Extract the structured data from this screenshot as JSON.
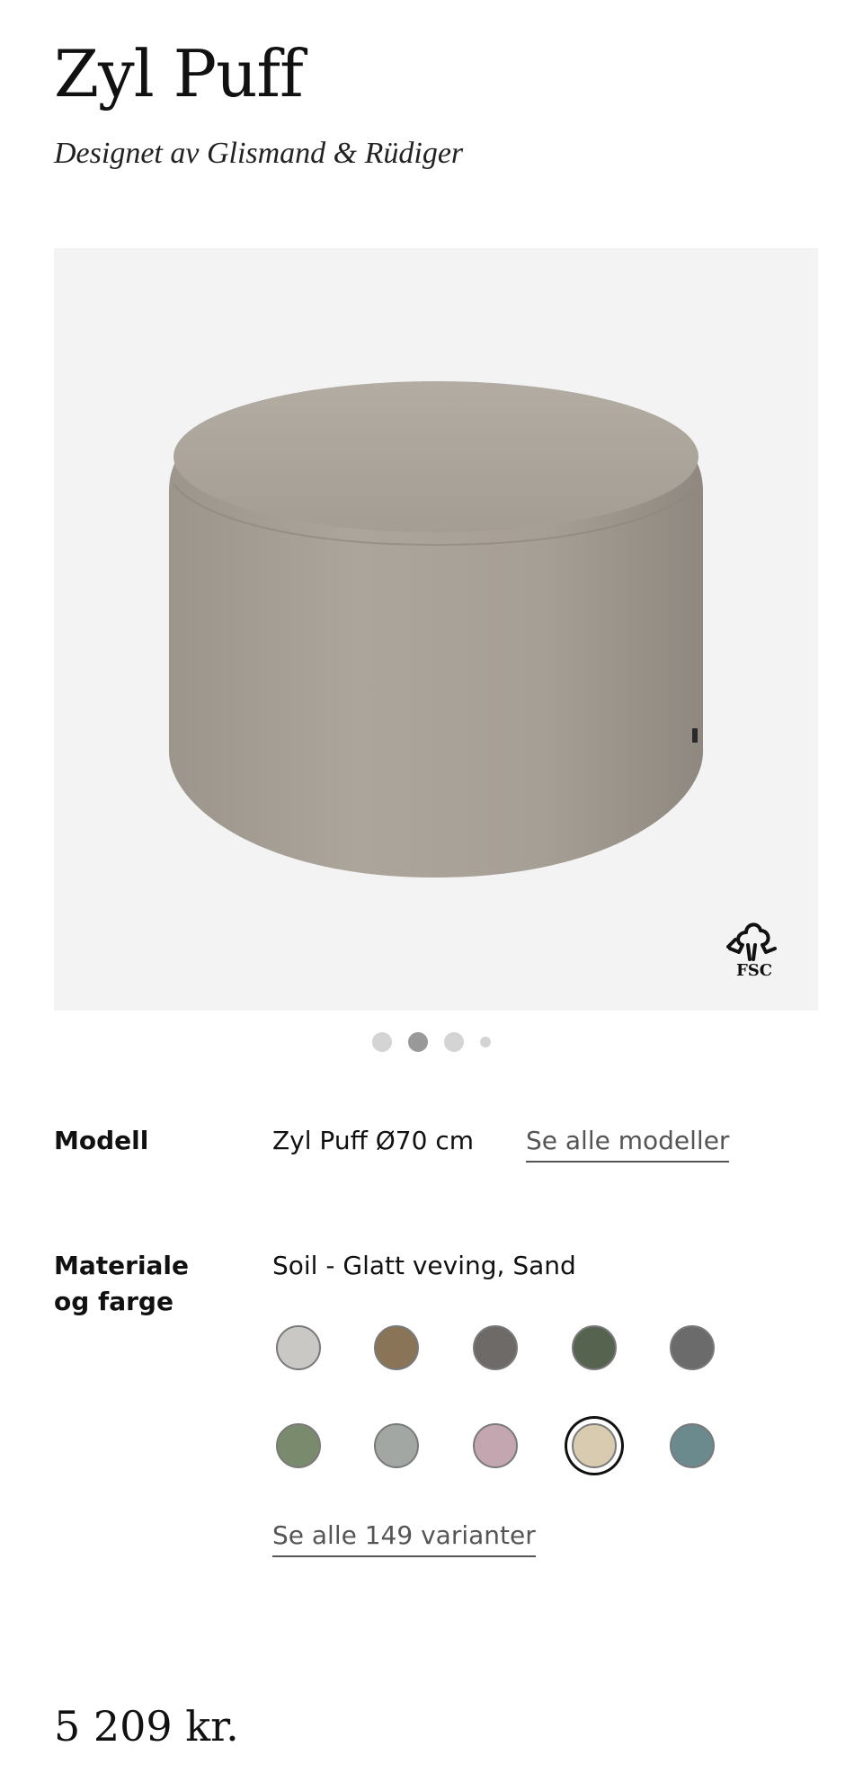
{
  "product": {
    "name": "Zyl Puff",
    "designer": "Designet av Glismand & Rüdiger",
    "price": "5 209 kr."
  },
  "gallery": {
    "image_alt": "pouf-image",
    "badge_label": "FSC",
    "dot_count": 4,
    "active_dot": 2
  },
  "model": {
    "label": "Modell",
    "value": "Zyl Puff Ø70 cm",
    "link_label": "Se alle modeller"
  },
  "material": {
    "label_line1": "Materiale",
    "label_line2": "og farge",
    "value": "Soil - Glatt veving, Sand",
    "all_variants_label": "Se alle 149 varianter",
    "swatches": [
      {
        "color": "#c9c8c5"
      },
      {
        "color": "#8a7458"
      },
      {
        "color": "#6d6a67"
      },
      {
        "color": "#56634f"
      },
      {
        "color": "#6b6b6b"
      },
      {
        "color": "#7a8a6c"
      },
      {
        "color": "#a2a7a3"
      },
      {
        "color": "#c4a6b1"
      },
      {
        "color": "#d9cbb0",
        "selected": true
      },
      {
        "color": "#6b8a8d"
      }
    ]
  }
}
